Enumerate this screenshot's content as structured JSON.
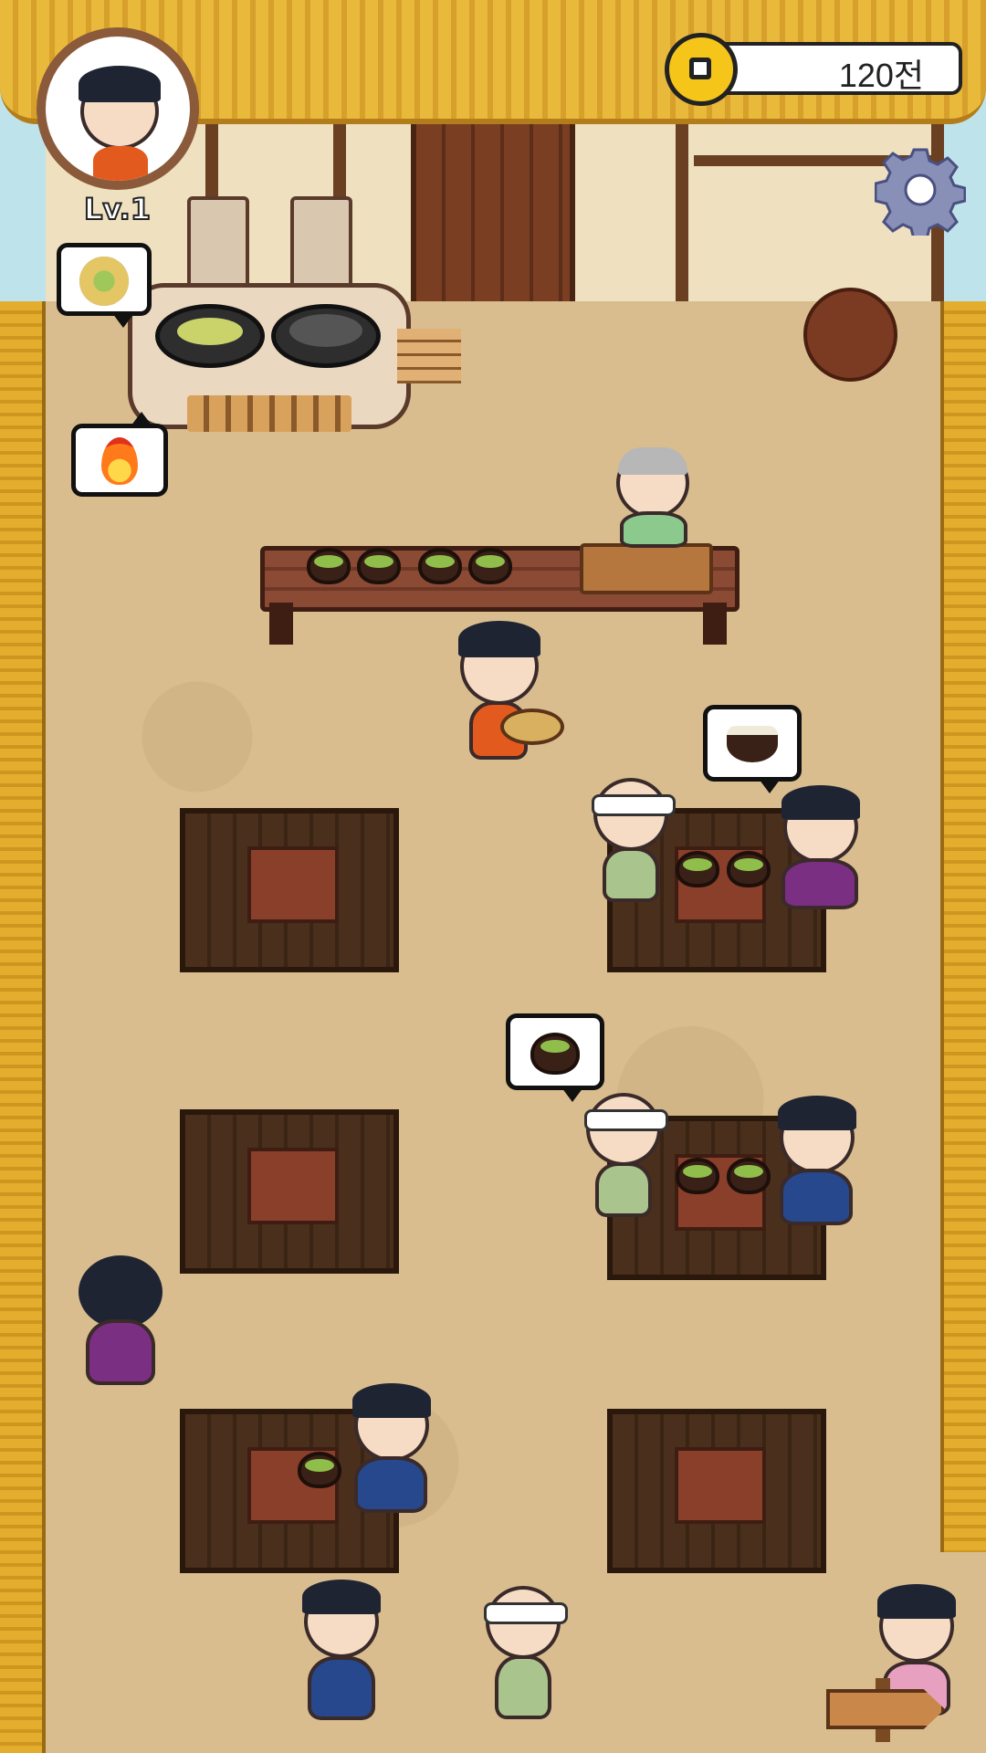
{
  "hud": {
    "level_label": "Lv.1",
    "currency_amount": "120전",
    "icons": {
      "avatar": "player-avatar-icon",
      "coin": "coin-icon",
      "settings": "gear-icon",
      "fire": "fire-icon",
      "pancake": "pancake-icon",
      "rice": "rice-bowl-icon",
      "soup": "soup-bowl-icon",
      "exit": "signpost-icon"
    }
  },
  "colors": {
    "thatch": "#e9b93c",
    "ground": "#d9bd8f",
    "wood": "#3a2414",
    "coin": "#f5c51a"
  }
}
